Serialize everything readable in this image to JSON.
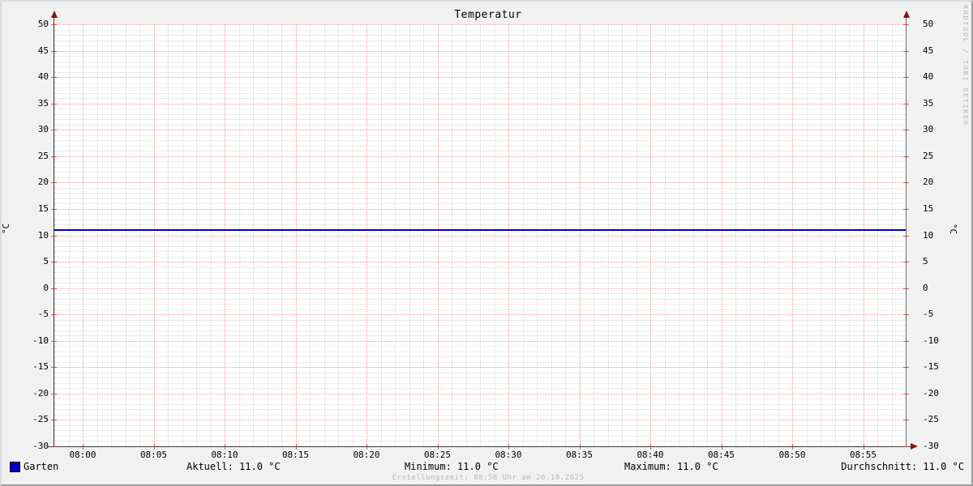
{
  "title": "Temperatur",
  "watermark": "RRDTOOL / TOBI OETIKER",
  "footer": "Erstellungszeit: 08:58 Uhr am 26.10.2025",
  "axis": {
    "left_unit": "°C",
    "right_unit": "°C"
  },
  "legend": {
    "series_name": "Garten",
    "series_swatch_color": "#0000c0",
    "stats": {
      "aktuell": "Aktuell: 11.0 °C",
      "minimum": "Minimum: 11.0 °C",
      "maximum": "Maximum: 11.0 °C",
      "durchschnitt": "Durchschnitt: 11.0 °C"
    }
  },
  "colors": {
    "series_line": "#0000b8",
    "major_grid": "rgba(220,60,60,0.50)",
    "minor_grid": "rgba(80,80,80,0.22)",
    "arrow": "#8b1010",
    "background": "#f1f1f1",
    "canvas": "#ffffff"
  },
  "chart_data": {
    "type": "line",
    "title": "Temperatur",
    "ylabel": "°C",
    "xlabel": "",
    "ylim": [
      -30,
      50
    ],
    "y_major_step": 5,
    "y_minor_step": 1,
    "y_ticks": [
      50,
      45,
      40,
      35,
      30,
      25,
      20,
      15,
      10,
      5,
      0,
      -5,
      -10,
      -15,
      -20,
      -25,
      -30
    ],
    "x_start_time": "07:58",
    "x_end_time": "08:58",
    "x_major_step_minutes": 5,
    "x_minor_step_minutes": 1,
    "x_ticks": [
      "08:00",
      "08:05",
      "08:10",
      "08:15",
      "08:20",
      "08:25",
      "08:30",
      "08:35",
      "08:40",
      "08:45",
      "08:50",
      "08:55"
    ],
    "grid": true,
    "legend_position": "bottom",
    "series": [
      {
        "name": "Garten",
        "color": "#0000b8",
        "x": [
          "07:58",
          "08:58"
        ],
        "values": [
          11.0,
          11.0
        ]
      }
    ],
    "stats": {
      "aktuell_c": 11.0,
      "minimum_c": 11.0,
      "maximum_c": 11.0,
      "durchschnitt_c": 11.0
    }
  }
}
